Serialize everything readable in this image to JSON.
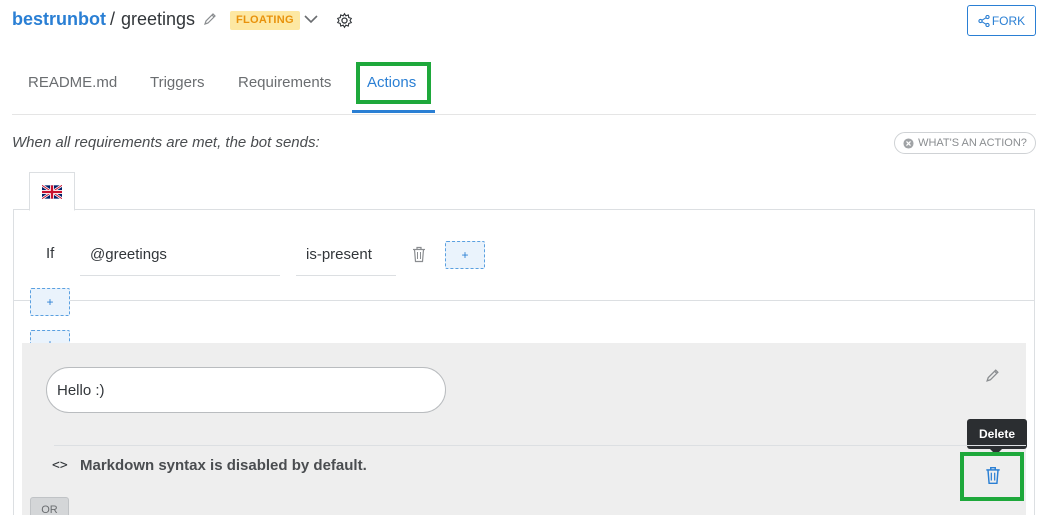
{
  "header": {
    "owner": "bestrunbot",
    "separator": "/",
    "bot_name": "greetings",
    "status_badge": "FLOATING",
    "fork_label": "FORK"
  },
  "tabs": [
    {
      "label": "README.md"
    },
    {
      "label": "Triggers"
    },
    {
      "label": "Requirements"
    },
    {
      "label": "Actions",
      "active": true
    }
  ],
  "actions_page": {
    "intro": "When all requirements are met, the bot sends:",
    "help_button": "WHAT'S AN ACTION?",
    "language_flag": "uk-flag",
    "condition": {
      "if_label": "If",
      "intent": "@greetings",
      "operator": "is-present",
      "add_label": "+"
    },
    "add_requirement_label": "+",
    "add_action_label": "+",
    "message": "Hello :)",
    "tooltip": "Delete",
    "markdown_note": "Markdown syntax is disabled by default.",
    "code_icon_glyph": "<>",
    "or_label": "OR"
  },
  "colors": {
    "accent": "#2a7fd4",
    "badge_bg": "#fde8a3",
    "badge_text": "#e8920c",
    "highlight": "#1ea83b"
  }
}
